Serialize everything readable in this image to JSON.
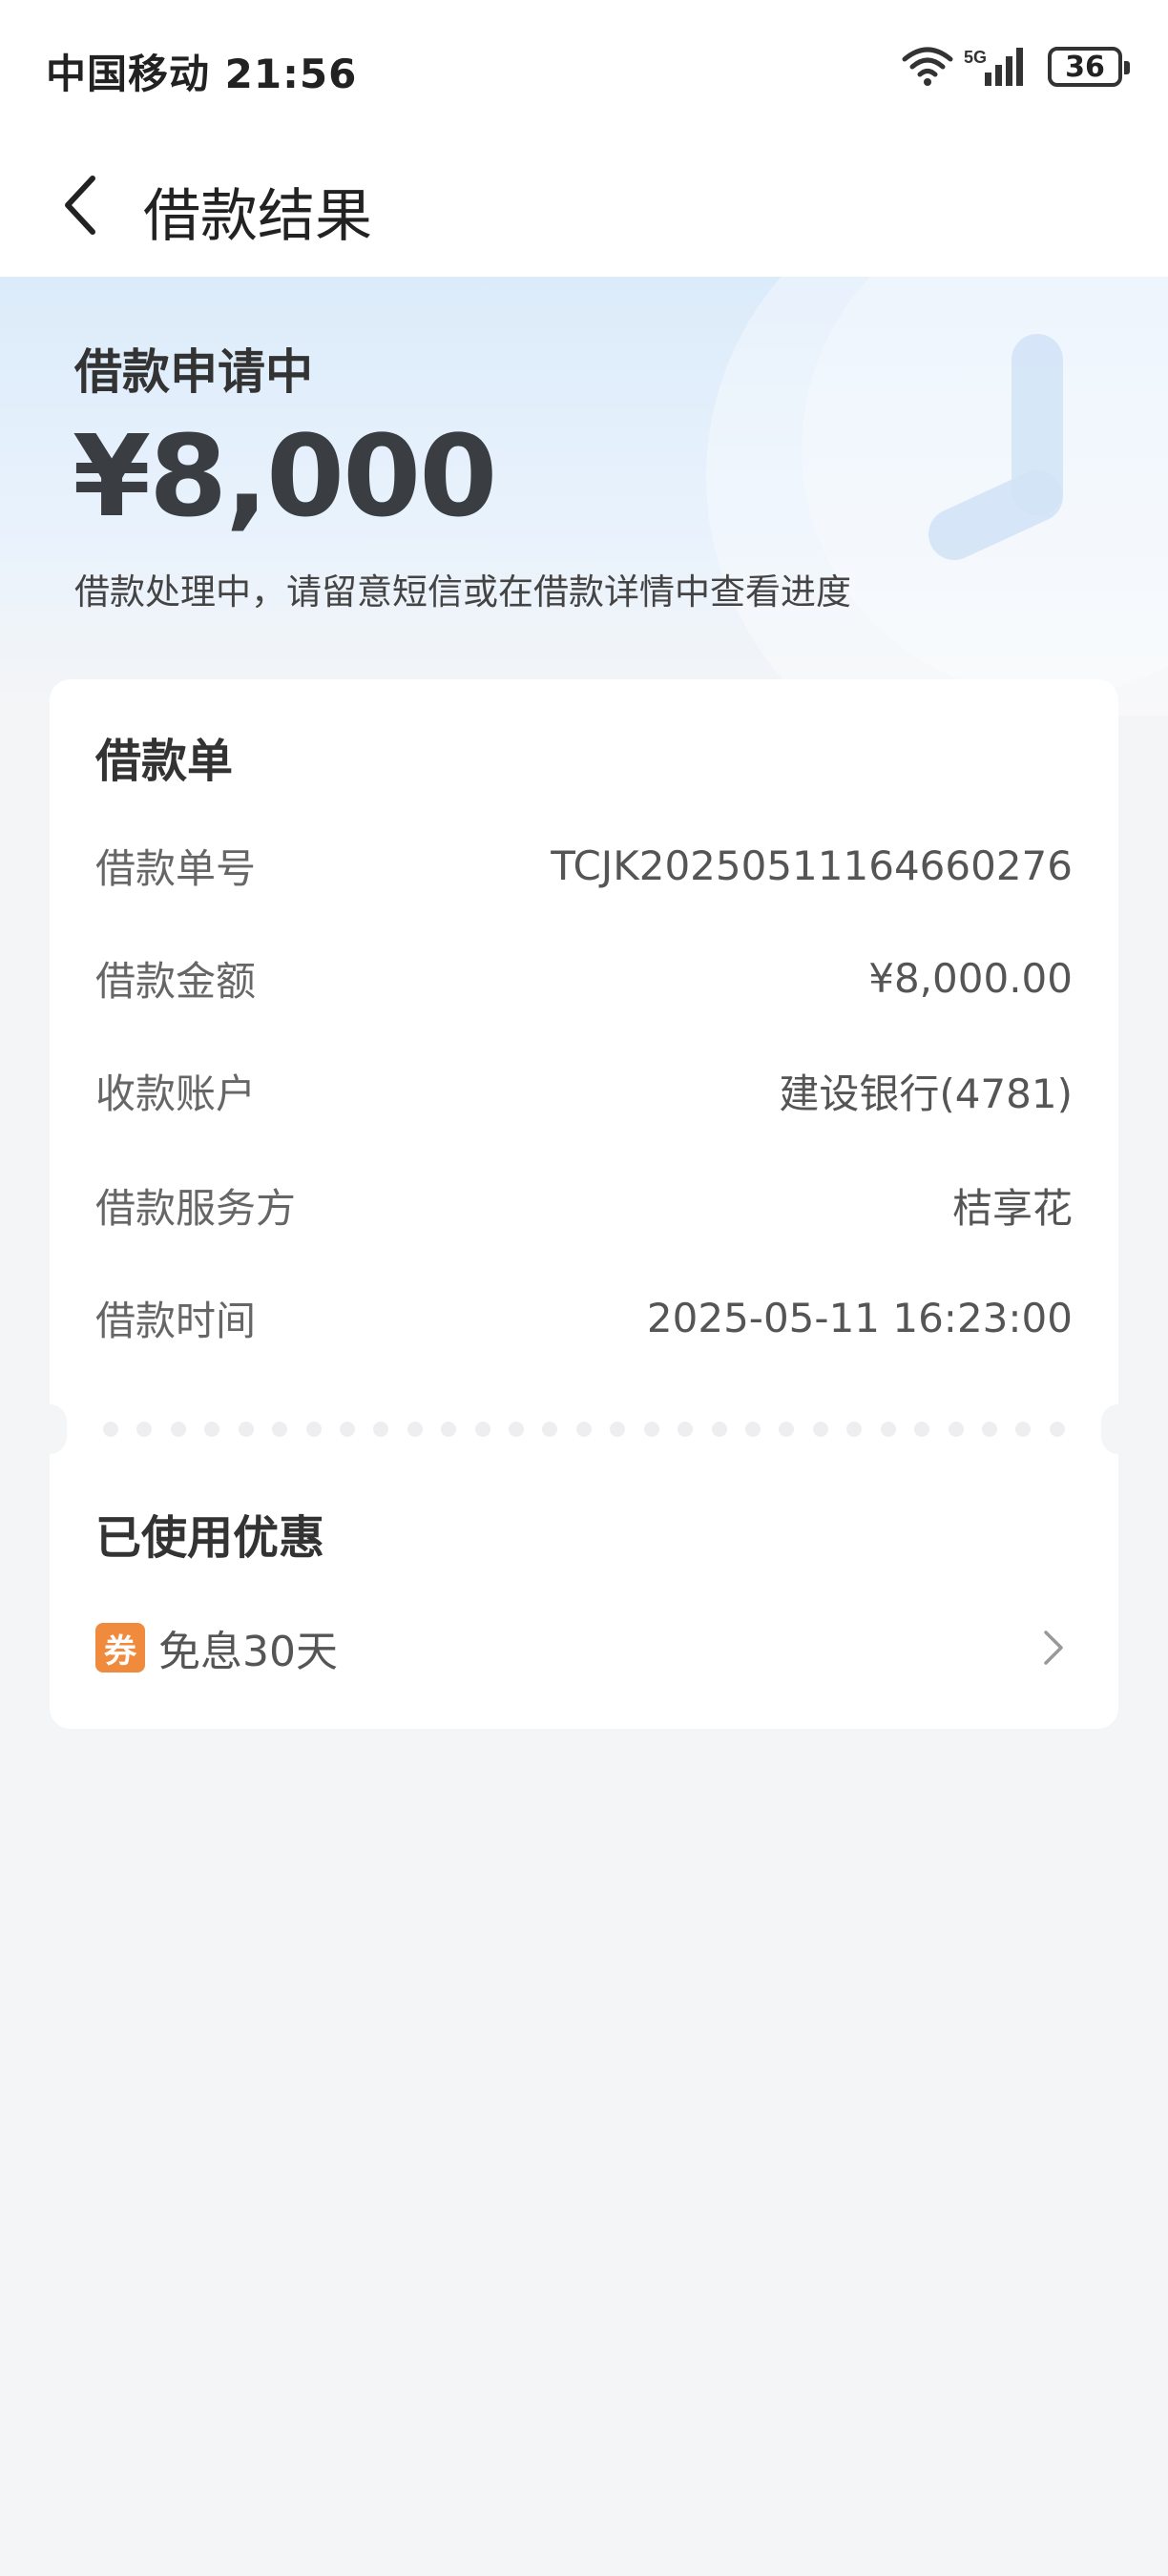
{
  "status_bar": {
    "carrier_time": "中国移动 21:56",
    "network": "5G",
    "battery": "36",
    "icons": [
      "wifi-icon",
      "signal-icon",
      "battery-icon"
    ]
  },
  "nav": {
    "back_icon": "chevron-left-icon",
    "title": "借款结果"
  },
  "hero": {
    "status": "借款申请中",
    "amount": "¥8,000",
    "note": "借款处理中，请留意短信或在借款详情中查看进度"
  },
  "order": {
    "title": "借款单",
    "rows": [
      {
        "label": "借款单号",
        "value": "TCJK20250511164660276"
      },
      {
        "label": "借款金额",
        "value": "¥8,000.00"
      },
      {
        "label": "收款账户",
        "value": "建设银行(4781)"
      },
      {
        "label": "借款服务方",
        "value": "桔享花"
      },
      {
        "label": "借款时间",
        "value": "2025-05-11 16:23:00"
      }
    ]
  },
  "promotion": {
    "title": "已使用优惠",
    "badge": "券",
    "text": "免息30天",
    "arrow_icon": "chevron-right-icon"
  },
  "colors": {
    "hero_gradient_top": "#dcebfa",
    "page_bg": "#f4f5f7",
    "coupon_badge": "#f08a3c"
  }
}
